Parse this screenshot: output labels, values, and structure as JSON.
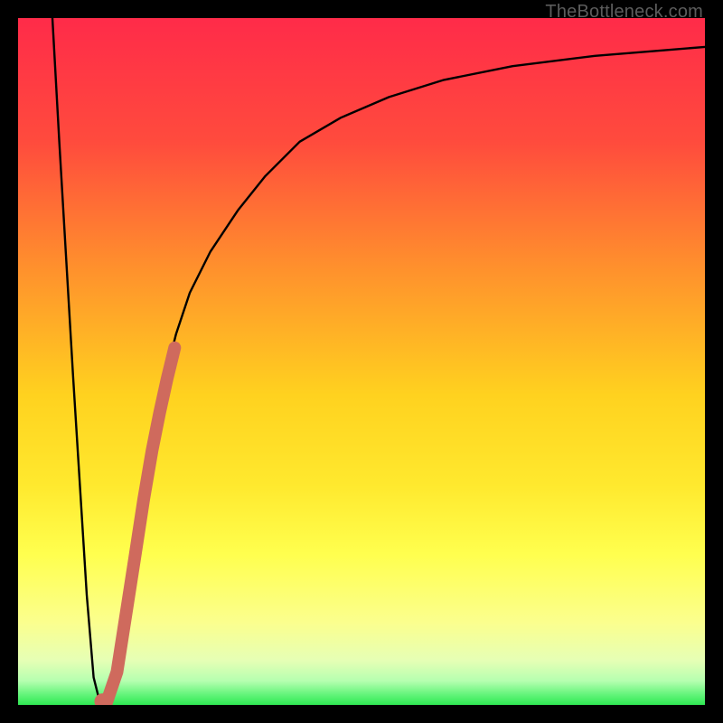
{
  "watermark": "TheBottleneck.com",
  "colors": {
    "frame": "#000000",
    "curve": "#000000",
    "highlight": "#cf6a5d",
    "green": "#2fe852",
    "gradient_stops": [
      {
        "offset": 0.0,
        "color": "#ff2b49"
      },
      {
        "offset": 0.18,
        "color": "#ff4b3d"
      },
      {
        "offset": 0.36,
        "color": "#ff8f2d"
      },
      {
        "offset": 0.55,
        "color": "#ffd21f"
      },
      {
        "offset": 0.68,
        "color": "#ffe92e"
      },
      {
        "offset": 0.78,
        "color": "#ffff4e"
      },
      {
        "offset": 0.88,
        "color": "#fbff8e"
      },
      {
        "offset": 0.935,
        "color": "#e6ffb5"
      },
      {
        "offset": 0.965,
        "color": "#b6ffb0"
      },
      {
        "offset": 0.985,
        "color": "#63f47a"
      },
      {
        "offset": 1.0,
        "color": "#2fe852"
      }
    ]
  },
  "chart_data": {
    "type": "line",
    "title": "",
    "xlabel": "",
    "ylabel": "",
    "xlim": [
      0,
      100
    ],
    "ylim": [
      0,
      100
    ],
    "series": [
      {
        "name": "bottleneck-curve",
        "x": [
          5,
          6,
          8,
          10,
          11,
          12,
          13,
          14,
          15,
          17,
          19,
          21,
          23,
          25,
          28,
          32,
          36,
          41,
          47,
          54,
          62,
          72,
          84,
          100
        ],
        "y": [
          100,
          82,
          48,
          16,
          4,
          0,
          2,
          6,
          12,
          24,
          36,
          46,
          54,
          60,
          66,
          72,
          77,
          82,
          85.5,
          88.5,
          91,
          93,
          94.5,
          95.8
        ]
      }
    ],
    "highlight_segment": {
      "name": "recommended-range",
      "x": [
        12.3,
        12.9,
        14.4,
        17.0,
        18.3,
        19.5,
        20.6,
        21.7,
        22.8
      ],
      "y": [
        0.5,
        0.4,
        4.8,
        21.5,
        30.0,
        37.0,
        42.5,
        47.5,
        52.0
      ]
    }
  }
}
